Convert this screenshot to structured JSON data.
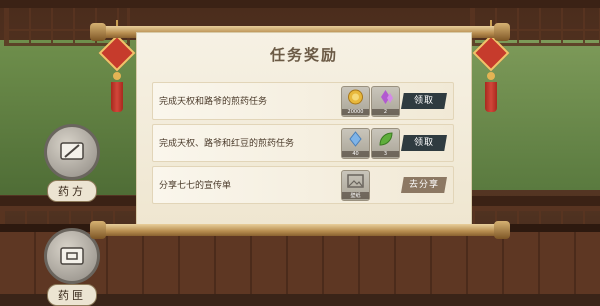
{
  "panel": {
    "title": "任务奖励"
  },
  "tasks": [
    {
      "text": "完成天权和路爷的煎药任务",
      "rewards": [
        {
          "icon": "gold-coin-icon",
          "qty": "20000"
        },
        {
          "icon": "purple-crystal-icon",
          "qty": "2"
        }
      ],
      "button": "领取"
    },
    {
      "text": "完成天权、路爷和红豆的煎药任务",
      "rewards": [
        {
          "icon": "blue-crystal-icon",
          "qty": "40"
        },
        {
          "icon": "green-leaf-icon",
          "qty": "3"
        }
      ],
      "button": "领取"
    },
    {
      "text": "分享七七的宣传单",
      "rewards": [
        {
          "icon": "picture-icon",
          "qty": "壁纸"
        }
      ],
      "button": "去分享"
    }
  ],
  "side_buttons": [
    {
      "label": "药方",
      "icon": "recipe-icon"
    },
    {
      "label": "药匣",
      "icon": "medicine-box-icon"
    }
  ],
  "colors": {
    "claim_button": "#2f3b40",
    "share_button": "#8c7863",
    "paper": "#f6f1e4"
  }
}
